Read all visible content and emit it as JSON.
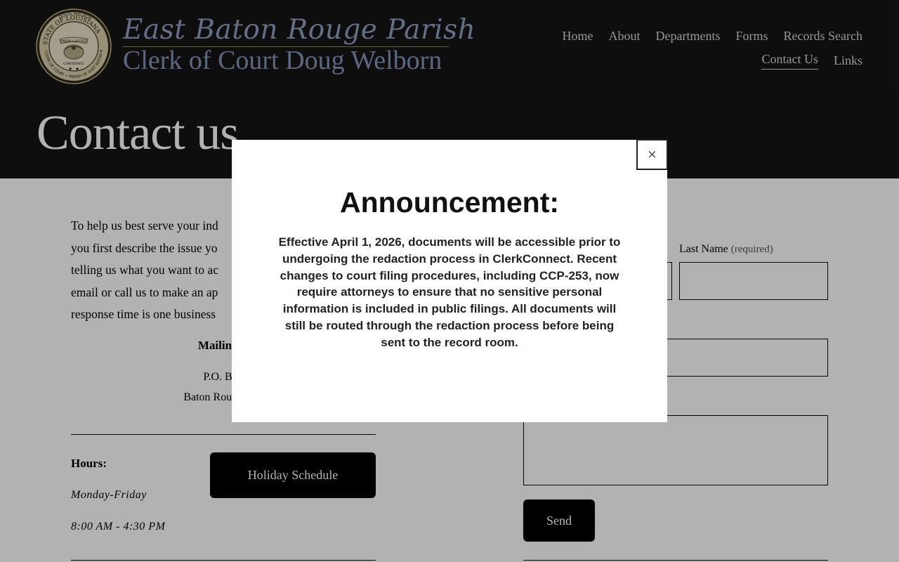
{
  "header": {
    "seal_text": {
      "ring_top": "DOUG WELBORN",
      "ring_upper": "STATE OF LOUISIANA",
      "ring_lower": "CLERK OF COURT • PARISH OF EAST BATON ROUGE",
      "banner": "UNION • JUSTICE",
      "banner2": "CONFIDENCE"
    },
    "brand_script": "East Baton Rouge Parish",
    "brand_subtitle": "Clerk of Court Doug Welborn",
    "nav_row1": [
      "Home",
      "About",
      "Departments",
      "Forms",
      "Records Search"
    ],
    "nav_row2": [
      "Contact Us",
      "Links"
    ],
    "active_nav": "Contact Us",
    "page_title": "Contact us"
  },
  "intro_lines": [
    "To help us best serve your ind",
    "you first describe the issue yo",
    "telling us what you want to ac",
    "email or call us to make an ap",
    "response time is one business"
  ],
  "mailing": {
    "heading": "Mailing A",
    "line1": "P.O. Box",
    "line2": "Baton Rouge, LA"
  },
  "hours": {
    "label": "Hours:",
    "days": "Monday-Friday",
    "time": "8:00 AM - 4:30 PM",
    "holiday_button": "Holiday Schedule"
  },
  "form": {
    "last_name_label": "Last Name",
    "required_note": "(required)",
    "send_button": "Send"
  },
  "modal": {
    "close_symbol": "×",
    "title": "Announcement:",
    "body": "Effective April 1, 2026, documents will be accessible prior to undergoing the redaction process in ClerkConnect. Recent changes to court filing procedures, including CCP-253, now require attorneys to ensure that no sensitive personal information is included in public filings. All documents will still be routed through the redaction process before being sent to the record room."
  },
  "colors": {
    "header_bg": "#151515",
    "brand_blue": "#8fa0c2",
    "brand_gold": "#9a8a4e",
    "button_bg": "#000000",
    "overlay": "rgba(0,0,0,0.30)"
  }
}
